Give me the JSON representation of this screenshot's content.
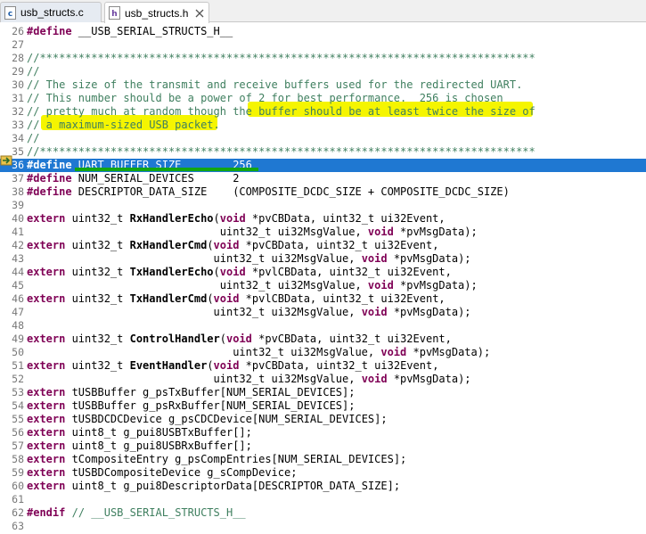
{
  "tabs": [
    {
      "label": "usb_structs.c",
      "icon": "c-file-icon",
      "active": false
    },
    {
      "label": "usb_structs.h",
      "icon": "h-file-icon",
      "active": true,
      "close": "close-icon"
    }
  ],
  "colors": {
    "keyword": "#7f0055",
    "comment": "#3f7f5f",
    "current_line": "#1f78d2",
    "highlight": "#f5f500",
    "highlight_green": "#12a612"
  },
  "lines": [
    {
      "n": "26",
      "segs": [
        {
          "t": "#define",
          "c": "kw"
        },
        {
          "t": " __USB_SERIAL_STRUCTS_H__"
        }
      ]
    },
    {
      "n": "27",
      "segs": []
    },
    {
      "n": "28",
      "segs": [
        {
          "t": "//*****************************************************************************",
          "c": "cm"
        }
      ]
    },
    {
      "n": "29",
      "segs": [
        {
          "t": "//",
          "c": "cm"
        }
      ]
    },
    {
      "n": "30",
      "segs": [
        {
          "t": "// The size of the transmit and receive buffers used for the redirected UART.",
          "c": "cm"
        }
      ]
    },
    {
      "n": "31",
      "segs": [
        {
          "t": "// This number should be a power of 2 for best performance.  256 is chosen",
          "c": "cm"
        }
      ]
    },
    {
      "n": "32",
      "segs": [
        {
          "t": "// pretty much at random though the buffer should be at least twice the size of",
          "c": "cm"
        }
      ]
    },
    {
      "n": "33",
      "segs": [
        {
          "t": "// a maximum-sized USB packet.",
          "c": "cm"
        }
      ]
    },
    {
      "n": "34",
      "segs": [
        {
          "t": "//",
          "c": "cm"
        }
      ]
    },
    {
      "n": "35",
      "segs": [
        {
          "t": "//*****************************************************************************",
          "c": "cm"
        }
      ]
    },
    {
      "n": "36",
      "cur": true,
      "segs": [
        {
          "t": "#define",
          "c": "kw"
        },
        {
          "t": " UART_BUFFER_SIZE        256"
        }
      ]
    },
    {
      "n": "37",
      "segs": [
        {
          "t": "#define",
          "c": "kw"
        },
        {
          "t": " NUM_SERIAL_DEVICES      2"
        }
      ]
    },
    {
      "n": "38",
      "segs": [
        {
          "t": "#define",
          "c": "kw"
        },
        {
          "t": " DESCRIPTOR_DATA_SIZE    (COMPOSITE_DCDC_SIZE + COMPOSITE_DCDC_SIZE)"
        }
      ]
    },
    {
      "n": "39",
      "segs": []
    },
    {
      "n": "40",
      "segs": [
        {
          "t": "extern",
          "c": "kw"
        },
        {
          "t": " uint32_t "
        },
        {
          "t": "RxHandlerEcho",
          "c": "fn"
        },
        {
          "t": "("
        },
        {
          "t": "void",
          "c": "kw"
        },
        {
          "t": " *pvCBData, uint32_t ui32Event,"
        }
      ]
    },
    {
      "n": "41",
      "segs": [
        {
          "t": "                              uint32_t ui32MsgValue, "
        },
        {
          "t": "void",
          "c": "kw"
        },
        {
          "t": " *pvMsgData);"
        }
      ]
    },
    {
      "n": "42",
      "segs": [
        {
          "t": "extern",
          "c": "kw"
        },
        {
          "t": " uint32_t "
        },
        {
          "t": "RxHandlerCmd",
          "c": "fn"
        },
        {
          "t": "("
        },
        {
          "t": "void",
          "c": "kw"
        },
        {
          "t": " *pvCBData, uint32_t ui32Event,"
        }
      ]
    },
    {
      "n": "43",
      "segs": [
        {
          "t": "                             uint32_t ui32MsgValue, "
        },
        {
          "t": "void",
          "c": "kw"
        },
        {
          "t": " *pvMsgData);"
        }
      ]
    },
    {
      "n": "44",
      "segs": [
        {
          "t": "extern",
          "c": "kw"
        },
        {
          "t": " uint32_t "
        },
        {
          "t": "TxHandlerEcho",
          "c": "fn"
        },
        {
          "t": "("
        },
        {
          "t": "void",
          "c": "kw"
        },
        {
          "t": " *pvlCBData, uint32_t ui32Event,"
        }
      ]
    },
    {
      "n": "45",
      "segs": [
        {
          "t": "                              uint32_t ui32MsgValue, "
        },
        {
          "t": "void",
          "c": "kw"
        },
        {
          "t": " *pvMsgData);"
        }
      ]
    },
    {
      "n": "46",
      "segs": [
        {
          "t": "extern",
          "c": "kw"
        },
        {
          "t": " uint32_t "
        },
        {
          "t": "TxHandlerCmd",
          "c": "fn"
        },
        {
          "t": "("
        },
        {
          "t": "void",
          "c": "kw"
        },
        {
          "t": " *pvlCBData, uint32_t ui32Event,"
        }
      ]
    },
    {
      "n": "47",
      "segs": [
        {
          "t": "                             uint32_t ui32MsgValue, "
        },
        {
          "t": "void",
          "c": "kw"
        },
        {
          "t": " *pvMsgData);"
        }
      ]
    },
    {
      "n": "48",
      "segs": []
    },
    {
      "n": "49",
      "segs": [
        {
          "t": "extern",
          "c": "kw"
        },
        {
          "t": " uint32_t "
        },
        {
          "t": "ControlHandler",
          "c": "fn"
        },
        {
          "t": "("
        },
        {
          "t": "void",
          "c": "kw"
        },
        {
          "t": " *pvCBData, uint32_t ui32Event,"
        }
      ]
    },
    {
      "n": "50",
      "segs": [
        {
          "t": "                                uint32_t ui32MsgValue, "
        },
        {
          "t": "void",
          "c": "kw"
        },
        {
          "t": " *pvMsgData);"
        }
      ]
    },
    {
      "n": "51",
      "segs": [
        {
          "t": "extern",
          "c": "kw"
        },
        {
          "t": " uint32_t "
        },
        {
          "t": "EventHandler",
          "c": "fn"
        },
        {
          "t": "("
        },
        {
          "t": "void",
          "c": "kw"
        },
        {
          "t": " *pvCBData, uint32_t ui32Event,"
        }
      ]
    },
    {
      "n": "52",
      "segs": [
        {
          "t": "                             uint32_t ui32MsgValue, "
        },
        {
          "t": "void",
          "c": "kw"
        },
        {
          "t": " *pvMsgData);"
        }
      ]
    },
    {
      "n": "53",
      "segs": [
        {
          "t": "extern",
          "c": "kw"
        },
        {
          "t": " tUSBBuffer g_psTxBuffer[NUM_SERIAL_DEVICES];"
        }
      ]
    },
    {
      "n": "54",
      "segs": [
        {
          "t": "extern",
          "c": "kw"
        },
        {
          "t": " tUSBBuffer g_psRxBuffer[NUM_SERIAL_DEVICES];"
        }
      ]
    },
    {
      "n": "55",
      "segs": [
        {
          "t": "extern",
          "c": "kw"
        },
        {
          "t": " tUSBDCDCDevice g_psCDCDevice[NUM_SERIAL_DEVICES];"
        }
      ]
    },
    {
      "n": "56",
      "segs": [
        {
          "t": "extern",
          "c": "kw"
        },
        {
          "t": " uint8_t g_pui8USBTxBuffer[];"
        }
      ]
    },
    {
      "n": "57",
      "segs": [
        {
          "t": "extern",
          "c": "kw"
        },
        {
          "t": " uint8_t g_pui8USBRxBuffer[];"
        }
      ]
    },
    {
      "n": "58",
      "segs": [
        {
          "t": "extern",
          "c": "kw"
        },
        {
          "t": " tCompositeEntry g_psCompEntries[NUM_SERIAL_DEVICES];"
        }
      ]
    },
    {
      "n": "59",
      "segs": [
        {
          "t": "extern",
          "c": "kw"
        },
        {
          "t": " tUSBDCompositeDevice g_sCompDevice;"
        }
      ]
    },
    {
      "n": "60",
      "segs": [
        {
          "t": "extern",
          "c": "kw"
        },
        {
          "t": " uint8_t g_pui8DescriptorData[DESCRIPTOR_DATA_SIZE];"
        }
      ]
    },
    {
      "n": "61",
      "segs": []
    },
    {
      "n": "62",
      "segs": [
        {
          "t": "#endif",
          "c": "kw"
        },
        {
          "t": " "
        },
        {
          "t": "// __USB_SERIAL_STRUCTS_H__",
          "c": "cm"
        }
      ]
    },
    {
      "n": "63",
      "segs": []
    }
  ]
}
